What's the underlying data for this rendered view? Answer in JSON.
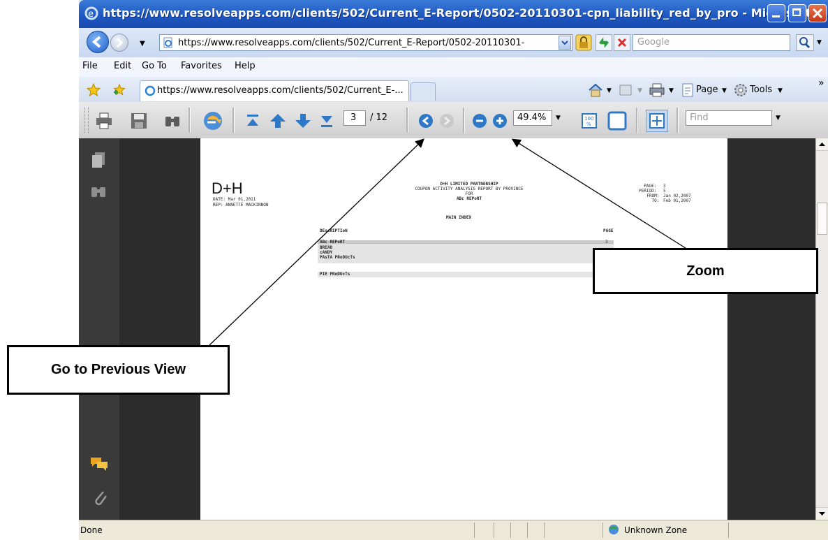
{
  "window": {
    "title": "https://www.resolveapps.com/clients/502/Current_E-Report/0502-20110301-cpn_liability_red_by_pro - Microsoft I..."
  },
  "address": {
    "url": "https://www.resolveapps.com/clients/502/Current_E-Report/0502-20110301-",
    "search_placeholder": "Google"
  },
  "menu": [
    "File",
    "Edit",
    "Go To",
    "Favorites",
    "Help"
  ],
  "tab": {
    "label": "https://www.resolveapps.com/clients/502/Current_E-..."
  },
  "commands": {
    "page": "Page",
    "tools": "Tools",
    "more": "»"
  },
  "pdf_toolbar": {
    "page_current": "3",
    "page_total": "/ 12",
    "zoom": "49.4%",
    "find_placeholder": "Find"
  },
  "report": {
    "logo": "D+H",
    "date_line": "DATE: Mar 01,2011",
    "rep_line": "REP: ANNETTE MACKINNON",
    "title1": "D+H LIMITED PARTNERSHIP",
    "title2": "COUPON ACTIVITY ANALYSIS REPORT BY PROVINCE",
    "title3": "FOR",
    "title4": "ABc REPoRT",
    "page_label": "PAGE:",
    "page_value": "3",
    "period_label": "PERIOD:",
    "period_value": "5",
    "from_label": "FROM:",
    "from_value": "Jan 02,2007",
    "to_label": "TO:",
    "to_value": "Feb 01,2007",
    "index_title": "MAIN INDEX",
    "col_description": "DEscRIPTIoN",
    "col_page": "PAGE",
    "rows": [
      {
        "desc": "ABc REPoRT",
        "page": "3"
      },
      {
        "desc": "BREAD",
        "page": ""
      },
      {
        "desc": "cANDY",
        "page": ""
      },
      {
        "desc": "PAsTA PRoDUcTs",
        "page": ""
      },
      {
        "desc": "PIE PRoDUcTs",
        "page": ""
      }
    ]
  },
  "status": {
    "left": "Done",
    "zone": "Unknown Zone"
  },
  "callouts": {
    "prev_view": "Go to Previous View",
    "zoom": "Zoom"
  }
}
